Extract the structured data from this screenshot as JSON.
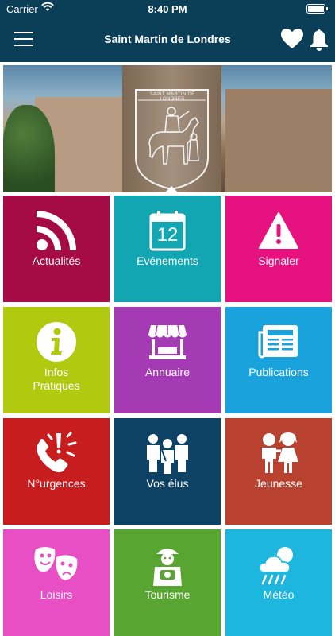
{
  "status_bar": {
    "carrier": "Carrier",
    "time": "8:40 PM"
  },
  "navbar": {
    "title": "Saint Martin de Londres"
  },
  "hero": {
    "town_label": "SAINT MARTIN DE LONDRES"
  },
  "tiles": [
    {
      "label": "Actualités",
      "icon": "rss-icon",
      "color": "#a50c45"
    },
    {
      "label": "Evénements",
      "icon": "calendar-icon",
      "date": "12",
      "color": "#12a6b2"
    },
    {
      "label": "Signaler",
      "icon": "warning-icon",
      "color": "#e6127f"
    },
    {
      "label": "Infos\nPratiques",
      "icon": "info-icon",
      "color": "#b1c90f"
    },
    {
      "label": "Annuaire",
      "icon": "shop-icon",
      "color": "#a53bb4"
    },
    {
      "label": "Publications",
      "icon": "newspaper-icon",
      "color": "#19a2dc"
    },
    {
      "label": "N°urgences",
      "icon": "phone-alert-icon",
      "color": "#c81d1f"
    },
    {
      "label": "Vos élus",
      "icon": "people-icon",
      "color": "#0d4264"
    },
    {
      "label": "Jeunesse",
      "icon": "kids-icon",
      "color": "#b8422f"
    },
    {
      "label": "Loisirs",
      "icon": "theater-masks-icon",
      "color": "#e84fc5"
    },
    {
      "label": "Tourisme",
      "icon": "tourist-icon",
      "color": "#58a531"
    },
    {
      "label": "Météo",
      "icon": "weather-icon",
      "color": "#1cb6de"
    }
  ]
}
